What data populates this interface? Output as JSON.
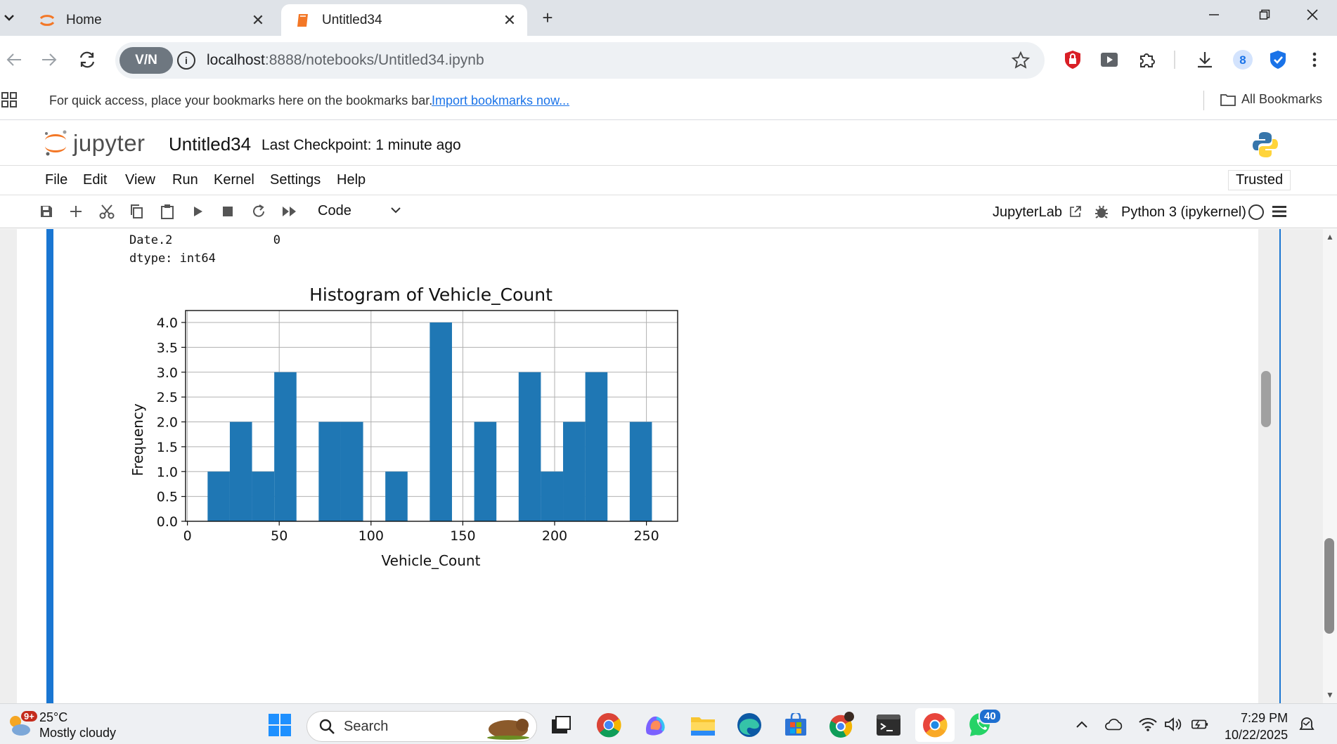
{
  "browser": {
    "tabs": [
      {
        "title": "Home",
        "active": false
      },
      {
        "title": "Untitled34",
        "active": true
      }
    ],
    "url_host": "localhost",
    "url_rest": ":8888/notebooks/Untitled34.ipynb",
    "vpn_label": "V/N",
    "bookmarks_prompt": "For quick access, place your bookmarks here on the bookmarks bar.",
    "bookmarks_import_link": "Import bookmarks now...",
    "all_bookmarks": "All Bookmarks",
    "profile_number": "8"
  },
  "jupyter": {
    "logo_text": "jupyter",
    "notebook_title": "Untitled34",
    "checkpoint": "Last Checkpoint: 1 minute ago",
    "menu": [
      "File",
      "Edit",
      "View",
      "Run",
      "Kernel",
      "Settings",
      "Help"
    ],
    "trusted": "Trusted",
    "cell_type": "Code",
    "jupyterlab_link": "JupyterLab",
    "kernel": "Python 3 (ipykernel)"
  },
  "output": {
    "line1_key": "Date.2",
    "line1_val": "0",
    "line2": "dtype: int64"
  },
  "chart_data": {
    "type": "bar",
    "title": "Histogram of Vehicle_Count",
    "xlabel": "Vehicle_Count",
    "ylabel": "Frequency",
    "xlim": [
      -1,
      267
    ],
    "ylim": [
      0,
      4.0
    ],
    "xticks": [
      0,
      50,
      100,
      150,
      200,
      250
    ],
    "yticks": [
      0.0,
      0.5,
      1.0,
      1.5,
      2.0,
      2.5,
      3.0,
      3.5,
      4.0
    ],
    "ytick_labels": [
      "0.0",
      "0.5",
      "1.0",
      "1.5",
      "2.0",
      "2.5",
      "3.0",
      "3.5",
      "4.0"
    ],
    "grid": true,
    "bar_color": "#1f77b4",
    "bin_start": 11,
    "bin_width": 12.1,
    "values": [
      1,
      2,
      1,
      3,
      0,
      2,
      2,
      0,
      1,
      0,
      4,
      0,
      2,
      0,
      3,
      1,
      2,
      3,
      0,
      2
    ]
  },
  "taskbar": {
    "weather_temp": "25°C",
    "weather_desc": "Mostly cloudy",
    "weather_badge": "9+",
    "search_placeholder": "Search",
    "whatsapp_badge": "40",
    "time": "7:29 PM",
    "date": "10/22/2025"
  },
  "colors": {
    "accent_blue": "#1976d2",
    "jupyter_orange": "#f37726",
    "bar_blue": "#1f77b4"
  }
}
